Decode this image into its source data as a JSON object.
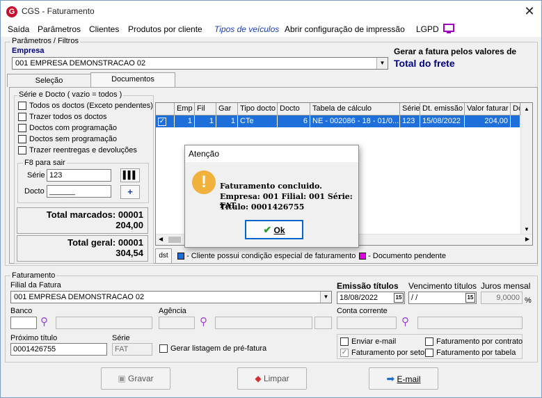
{
  "window": {
    "title": "CGS - Faturamento"
  },
  "menu": [
    "Saída",
    "Parâmetros",
    "Clientes",
    "Produtos por cliente",
    "Tipos de veículos",
    "Abrir configuração de impressão",
    "LGPD"
  ],
  "params": {
    "group_label": "Parâmetros / Filtros",
    "empresa_label": "Empresa",
    "empresa_value": "001 EMPRESA DEMONSTRACAO 02",
    "gerar_label": "Gerar a fatura pelos valores de",
    "gerar_value": "Total do frete"
  },
  "tabs": [
    "Seleção",
    "Documentos"
  ],
  "serie_group": {
    "label": "Série e Docto  ( vazio = todos )",
    "checks": [
      "Todos os doctos (Exceto pendentes)",
      "Trazer todos os doctos",
      "Doctos com programação",
      "Doctos sem programação",
      "Trazer reentregas e devoluções"
    ],
    "f8_label": "F8 para sair",
    "serie_label": "Série",
    "serie_value": "123",
    "docto_label": "Docto",
    "docto_value": "______"
  },
  "totals": {
    "marcados_label": "Total marcados: 00001",
    "marcados_value": "204,00",
    "geral_label": "Total geral: 00001",
    "geral_value": "304,54"
  },
  "grid": {
    "columns": [
      "Emp",
      "Fil",
      "Gar",
      "Tipo docto",
      "Docto",
      "Tabela de cálculo",
      "Série",
      "Dt. emissão",
      "Valor faturar",
      "Do"
    ],
    "rows": [
      [
        "1",
        "1",
        "1",
        "CTe",
        "6",
        "NE - 002086 - 18 - 01/0...",
        "123",
        "15/08/2022",
        "204,00",
        ""
      ]
    ]
  },
  "legend": {
    "btn": "dst",
    "cliente": "- Cliente possui condição especial de faturamento",
    "pendente": "- Documento pendente",
    "cliente_color": "#1e6fd9",
    "pendente_color": "#e000e0"
  },
  "dialog": {
    "title": "Atenção",
    "line1": "Faturamento concluido.",
    "line2": "Empresa: 001 Filial: 001 Série: FAT",
    "line3": "Título: 0001426755",
    "ok": "Ok"
  },
  "fat": {
    "group_label": "Faturamento",
    "filial_label": "Filial da Fatura",
    "filial_value": "001 EMPRESA DEMONSTRACAO 02",
    "emissao_label": "Emissão títulos",
    "emissao_value": "18/08/2022",
    "venc_label": "Vencimento títulos",
    "venc_value": " /  /",
    "juros_label": "Juros mensal",
    "juros_value": "9,0000",
    "juros_unit": "%",
    "banco_label": "Banco",
    "agencia_label": "Agência",
    "conta_label": "Conta corrente",
    "proximo_label": "Próximo título",
    "proximo_value": "0001426755",
    "serie_label": "Série",
    "serie_value": "FAT",
    "gerar_listagem": "Gerar listagem de pré-fatura",
    "enviar_email": "Enviar e-mail",
    "fat_contrato": "Faturamento por contrato",
    "fat_setor": "Faturamento por setor",
    "fat_tabela": "Faturamento por tabela"
  },
  "buttons": {
    "gravar": "Gravar",
    "limpar": "Limpar",
    "email": "E-mail"
  }
}
